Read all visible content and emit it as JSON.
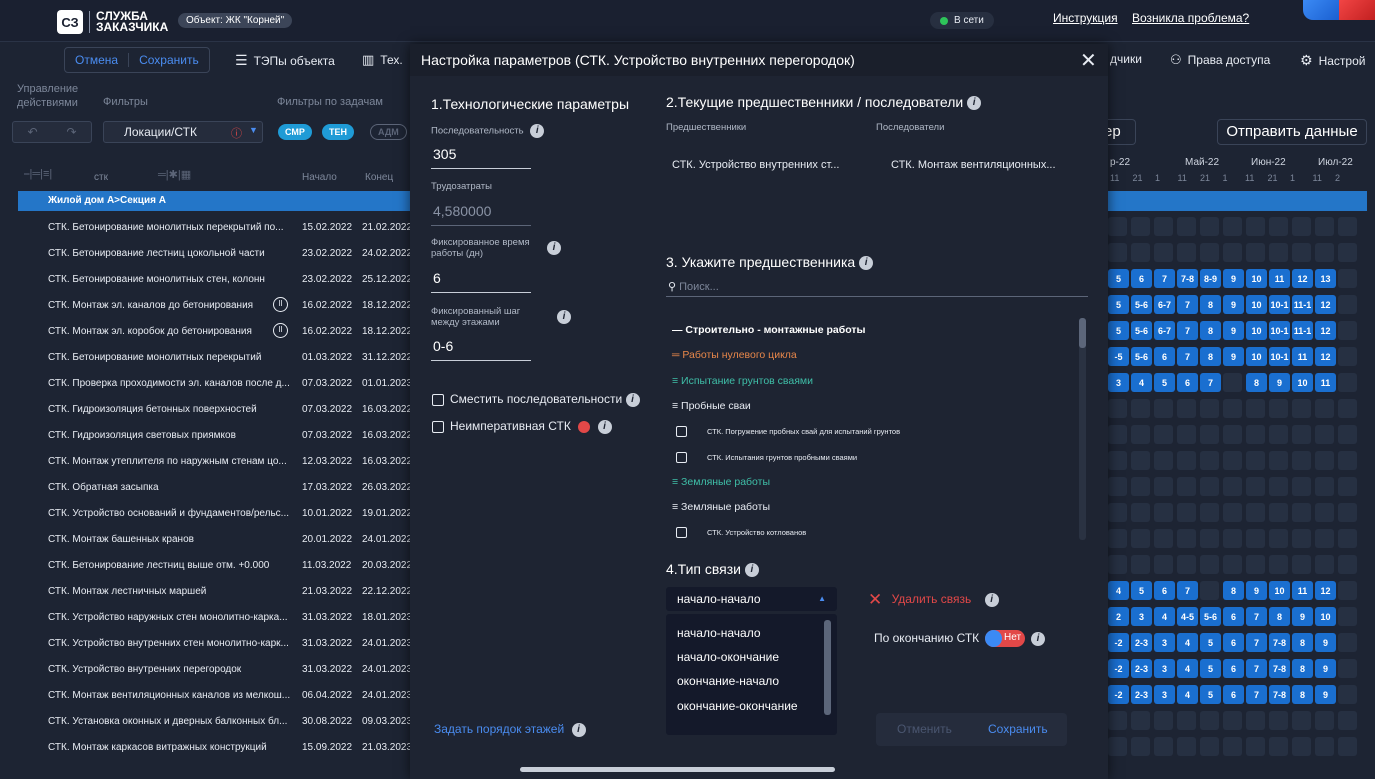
{
  "app": {
    "logo_mark": "СЗ",
    "logo_line1": "СЛУЖБА",
    "logo_line2": "ЗАКАЗЧИКА",
    "object_badge": "Объект: ЖК \"Корней\"",
    "online_status": "В сети",
    "link_instruction": "Инструкция",
    "link_problem": "Возникла проблема?",
    "accent_color": "#2476c8"
  },
  "toolbar": {
    "cancel_label": "Отмена",
    "save_label": "Сохранить",
    "teps_label": "ТЭПы объекта",
    "tex_label": "Тех.",
    "suppliers_label": "дчики",
    "access_label": "Права доступа",
    "settings_label": "Настрой"
  },
  "filters": {
    "management_line1": "Управление",
    "management_line2": "действиями",
    "filters_label": "Фильтры",
    "task_filters_label": "Фильтры по задачам",
    "location_select": "Локации/СТК",
    "pill_smr": "СМР",
    "pill_teh": "ТЕН",
    "pill_adm": "АДМ",
    "col_stk": "стк",
    "col_start": "Начало",
    "col_end": "Конец"
  },
  "table": {
    "group_label": "Жилой дом А>Секция А",
    "rows": [
      {
        "name": "СТК. Бетонирование монолитных перекрытий по...",
        "start": "15.02.2022",
        "end": "21.02.2022"
      },
      {
        "name": "СТК. Бетонирование лестниц цокольной части",
        "start": "23.02.2022",
        "end": "24.02.2022"
      },
      {
        "name": "СТК. Бетонирование монолитных стен, колонн",
        "start": "23.02.2022",
        "end": "25.12.2022"
      },
      {
        "name": "СТК. Монтаж эл. каналов до бетонирования",
        "start": "16.02.2022",
        "end": "18.12.2022",
        "pause": "II"
      },
      {
        "name": "СТК. Монтаж эл. коробок до бетонирования",
        "start": "16.02.2022",
        "end": "18.12.2022",
        "pause": "II"
      },
      {
        "name": "СТК. Бетонирование монолитных перекрытий",
        "start": "01.03.2022",
        "end": "31.12.2022"
      },
      {
        "name": "СТК. Проверка проходимости эл. каналов после д...",
        "start": "07.03.2022",
        "end": "01.01.2023"
      },
      {
        "name": "СТК. Гидроизоляция бетонных поверхностей",
        "start": "07.03.2022",
        "end": "16.03.2022"
      },
      {
        "name": "СТК. Гидроизоляция световых приямков",
        "start": "07.03.2022",
        "end": "16.03.2022"
      },
      {
        "name": "СТК. Монтаж утеплителя по наружным стенам цо...",
        "start": "12.03.2022",
        "end": "16.03.2022"
      },
      {
        "name": "СТК. Обратная засыпка",
        "start": "17.03.2022",
        "end": "26.03.2022"
      },
      {
        "name": "СТК. Устройство оснований и фундаментов/рельс...",
        "start": "10.01.2022",
        "end": "19.01.2022"
      },
      {
        "name": "СТК. Монтаж башенных кранов",
        "start": "20.01.2022",
        "end": "24.01.2022"
      },
      {
        "name": "СТК. Бетонирование лестниц выше отм. +0.000",
        "start": "11.03.2022",
        "end": "20.03.2022"
      },
      {
        "name": "СТК. Монтаж лестничных маршей",
        "start": "21.03.2022",
        "end": "22.12.2022"
      },
      {
        "name": "СТК. Устройство наружных стен монолитно-карка...",
        "start": "31.03.2022",
        "end": "18.01.2023"
      },
      {
        "name": "СТК. Устройство внутренних стен монолитно-карк...",
        "start": "31.03.2022",
        "end": "24.01.2023"
      },
      {
        "name": "СТК. Устройство внутренних перегородок",
        "start": "31.03.2022",
        "end": "24.01.2023"
      },
      {
        "name": "СТК. Монтаж вентиляционных каналов из мелкош...",
        "start": "06.04.2022",
        "end": "24.01.2023"
      },
      {
        "name": "СТК. Установка оконных и дверных балконных бл...",
        "start": "30.08.2022",
        "end": "09.03.2023"
      },
      {
        "name": "СТК. Монтаж каркасов витражных конструкций",
        "start": "15.09.2022",
        "end": "21.03.2023"
      }
    ]
  },
  "gantt": {
    "send_label": "Отправить данные",
    "ep_label": "ер",
    "months": [
      "р-22",
      "Май-22",
      "Июн-22",
      "Июл-22"
    ],
    "days": [
      "11",
      "21",
      "1",
      "11",
      "21",
      "1",
      "11",
      "21",
      "1",
      "11",
      "2"
    ]
  },
  "modal": {
    "title": "Настройка параметров (СТК. Устройство внутренних перегородок)",
    "sec1_title": "1.Технологические параметры",
    "seq_label": "Последовательность",
    "seq_value": "305",
    "labor_label": "Трудозатраты",
    "labor_value": "4,580000",
    "fixed_time_label1": "Фиксированное время",
    "fixed_time_label2": "работы (дн)",
    "fixed_time_value": "6",
    "fixed_step_label1": "Фиксированный шаг",
    "fixed_step_label2": "между этажами",
    "fixed_step_value": "0-6",
    "shift_seq_label": "Сместить последовательности",
    "non_imperative_label": "Неимперативная СТК",
    "floor_order_label": "Задать порядок этажей",
    "sec2_title": "2.Текущие предшественники / последователи",
    "predecessors_label": "Предшественники",
    "successors_label": "Последователи",
    "predecessor_value": "СТК. Устройство внутренних ст...",
    "successor_value": "СТК. Монтаж вентиляционных...",
    "sec3_title": "3. Укажите предшественника",
    "search_placeholder": "Поиск...",
    "tree": [
      {
        "label": "— Строительно - монтажные работы",
        "kind": "bold"
      },
      {
        "label": "═ Работы нулевого цикла",
        "kind": "orange"
      },
      {
        "label": "≡ Испытание грунтов сваями",
        "kind": "teal"
      },
      {
        "label": "≡ Пробные сваи",
        "kind": "white"
      },
      {
        "label": "СТК. Погружение пробных свай для испытаний грунтов",
        "kind": "check"
      },
      {
        "label": "СТК. Испытания грунтов пробными сваями",
        "kind": "check"
      },
      {
        "label": "≡ Земляные работы",
        "kind": "teal"
      },
      {
        "label": "≡ Земляные работы",
        "kind": "white"
      },
      {
        "label": "СТК. Устройство котлованов",
        "kind": "check"
      }
    ],
    "sec4_title": "4.Тип связи",
    "link_type_selected": "начало-начало",
    "link_type_options": [
      "начало-начало",
      "начало-окончание",
      "окончание-начало",
      "окончание-окончание"
    ],
    "delete_link_label": "Удалить связь",
    "on_end_label": "По окончанию СТК",
    "toggle_value": "Нет",
    "cancel_label": "Отменить",
    "save_label": "Сохранить"
  }
}
